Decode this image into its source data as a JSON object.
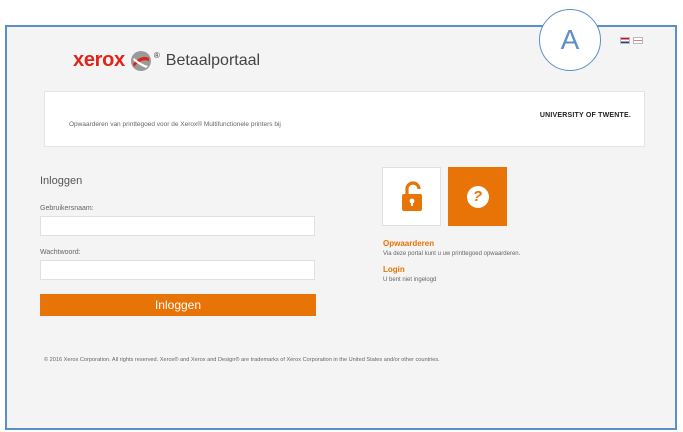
{
  "header": {
    "brand": "xerox",
    "trademark": "®",
    "portal_title": "Betaalportaal",
    "callout_label": "A",
    "languages": [
      {
        "code": "nl",
        "name": "Nederlands"
      },
      {
        "code": "en",
        "name": "English"
      }
    ]
  },
  "banner": {
    "text": "Opwaarderen van printtegoed voor de Xerox® Multifunctionele printers bij",
    "institution": "UNIVERSITY OF TWENTE."
  },
  "login": {
    "title": "Inloggen",
    "username_label": "Gebruikersnaam:",
    "username_value": "",
    "password_label": "Wachtwoord:",
    "password_value": "",
    "button_label": "Inloggen"
  },
  "tiles": {
    "lock_icon": "lock-icon",
    "help_icon": "help-icon",
    "help_glyph": "?",
    "accent_color": "#e87306"
  },
  "info": {
    "topup_title": "Opwaarderen",
    "topup_desc": "Via deze portal kunt u uw printtegoed opwaarderen.",
    "login_title": "Login",
    "login_status": "U bent niet ingelogd"
  },
  "footer": {
    "text": "© 2016 Xerox Corporation. All rights reserved. Xerox® and Xerox and Design® are trademarks of Xerox Corporation in the United States and/or other countries."
  }
}
